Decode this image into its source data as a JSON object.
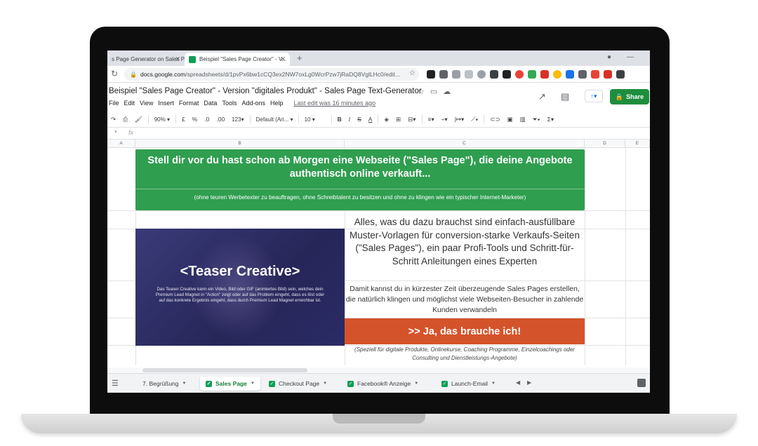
{
  "browser": {
    "tabs": [
      {
        "label": "s Page Generator on Sales P..."
      },
      {
        "label": "Beispiel \"Sales Page Creator\" - V..."
      }
    ],
    "address": {
      "host": "docs.google.com",
      "path": "/spreadsheets/d/1pvPx6bw1cCQ3ex2NW7oxLg0WcrPzw7jRaDQ8VglLHc0/edit..."
    }
  },
  "sheets": {
    "title": "Beispiel \"Sales Page Creator\" - Version \"digitales Produkt\" - Sales Page Text-Generator",
    "menu": [
      "File",
      "Edit",
      "View",
      "Insert",
      "Format",
      "Data",
      "Tools",
      "Add-ons",
      "Help"
    ],
    "last_edit": "Last edit was 16 minutes ago",
    "share_label": "Share",
    "toolbar": {
      "zoom": "90%",
      "currency": "£",
      "percent": "%",
      "dec_less": ".0",
      "dec_more": ".00",
      "number_format": "123",
      "font": "Default (Ari...",
      "size": "10",
      "bold": "B",
      "italic": "I",
      "strike": "S",
      "text_color": "A"
    },
    "formula": {
      "fx": "fx"
    },
    "columns": [
      "A",
      "B",
      "C",
      "D",
      "E"
    ]
  },
  "content": {
    "headline": "Stell dir vor du hast schon ab Morgen eine Webseite (\"Sales Page\"), die deine Angebote authentisch online verkauft...",
    "subheadline": "(ohne teuren Werbetexter zu beauftragen, ohne Schreibtalent zu besitzen und ohne zu klingen wie ein typischer Internet-Marketer)",
    "teaser_title": "<Teaser Creative>",
    "teaser_desc": "Das Teaser Creative kann ein Video, Bild oder GIF (animiertes Bild) sein, welches dein Premium Lead Magnet in \"Action\" zeigt oder auf das Problem eingeht, dass es löst oder auf das konkrete Ergebnis eingeht, dass durch Premium Lead Magnet erreichbar ist.",
    "main_copy": "Alles, was du dazu brauchst sind einfach-ausfüllbare Muster-Vorlagen für conversion-starke Verkaufs-Seiten (\"Sales Pages\"), ein paar Profi-Tools und Schritt-für-Schritt Anleitungen eines Experten",
    "sub_copy": "Damit kannst du in kürzester Zeit überzeugende Sales Pages erstellen, die natürlich klingen und möglichst viele Webseiten-Besucher in zahlende Kunden verwandeln",
    "cta_label": ">> Ja, das brauche ich!",
    "cta_note": "(Speziell für digitale Produkte, Onlinekurse, Coaching Programme, Einzelcoachings oder Consulting und Dienstleistungs-Angebote)"
  },
  "sheet_tabs": [
    {
      "label": "7. Begrüßung",
      "active": false
    },
    {
      "label": "Sales Page",
      "active": true
    },
    {
      "label": "Checkout Page",
      "active": false
    },
    {
      "label": "Facebook® Anzeige",
      "active": false
    },
    {
      "label": "Launch-Email",
      "active": false
    }
  ],
  "colors": {
    "hero_green": "#2f9e4f",
    "cta_orange": "#d5532a",
    "share_green": "#1e8e3e",
    "teaser_bg": "#2b2b66"
  }
}
